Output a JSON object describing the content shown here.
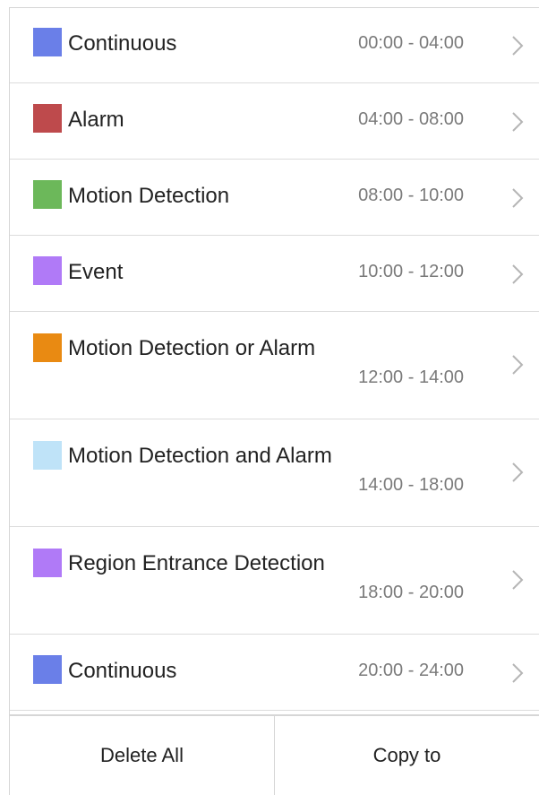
{
  "schedule": {
    "items": [
      {
        "label": "Continuous",
        "time": "00:00 - 04:00",
        "color": "#6a7fe8"
      },
      {
        "label": "Alarm",
        "time": "04:00 - 08:00",
        "color": "#be4a4c"
      },
      {
        "label": "Motion Detection",
        "time": "08:00 - 10:00",
        "color": "#6cb85a"
      },
      {
        "label": "Event",
        "time": "10:00 - 12:00",
        "color": "#b07af7"
      },
      {
        "label": "Motion Detection or Alarm",
        "time": "12:00 - 14:00",
        "color": "#e98a12"
      },
      {
        "label": "Motion Detection and Alarm",
        "time": "14:00 - 18:00",
        "color": "#bfe3f8"
      },
      {
        "label": "Region Entrance Detection",
        "time": "18:00 - 20:00",
        "color": "#b07af7"
      },
      {
        "label": "Continuous",
        "time": "20:00 - 24:00",
        "color": "#6a7fe8"
      }
    ],
    "chevron_icon": "chevron-right-icon"
  },
  "footer": {
    "delete_all_label": "Delete All",
    "copy_to_label": "Copy to"
  }
}
